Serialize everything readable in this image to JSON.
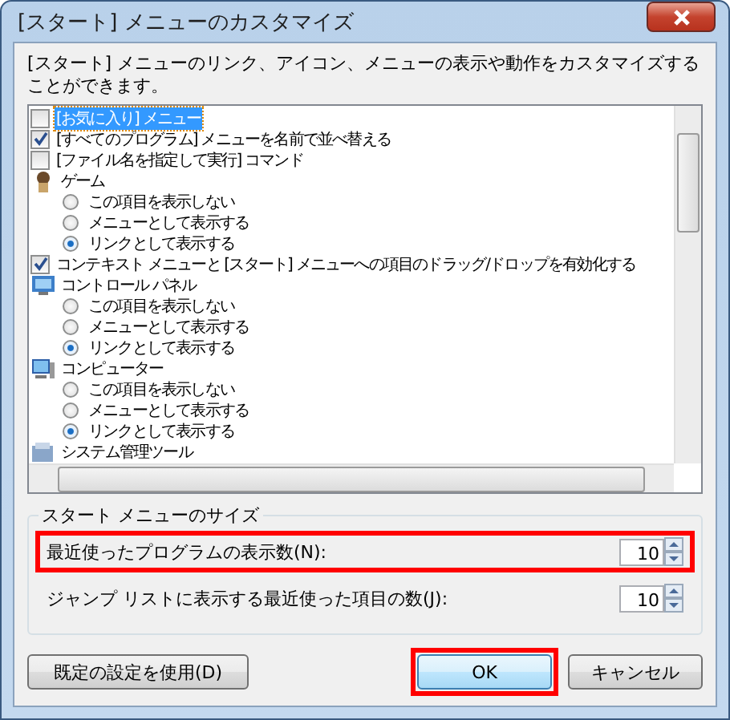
{
  "window": {
    "title": "[スタート] メニューのカスタマイズ"
  },
  "description": "[スタート] メニューのリンク、アイコン、メニューの表示や動作をカスタマイズすることができます。",
  "options": [
    {
      "kind": "checkbox",
      "label": "[お気に入り] メニュー",
      "checked": false,
      "selected": true
    },
    {
      "kind": "checkbox",
      "label": "[すべてのプログラム] メニューを名前で並べ替える",
      "checked": true,
      "selected": false
    },
    {
      "kind": "checkbox",
      "label": "[ファイル名を指定して実行] コマンド",
      "checked": false,
      "selected": false
    },
    {
      "kind": "group",
      "label": "ゲーム",
      "children": [
        {
          "label": "この項目を表示しない",
          "selected": false
        },
        {
          "label": "メニューとして表示する",
          "selected": false
        },
        {
          "label": "リンクとして表示する",
          "selected": true
        }
      ]
    },
    {
      "kind": "checkbox",
      "label": "コンテキスト メニューと [スタート] メニューへの項目のドラッグ/ドロップを有効化する",
      "checked": true,
      "selected": false
    },
    {
      "kind": "group",
      "label": "コントロール パネル",
      "children": [
        {
          "label": "この項目を表示しない",
          "selected": false
        },
        {
          "label": "メニューとして表示する",
          "selected": false
        },
        {
          "label": "リンクとして表示する",
          "selected": true
        }
      ]
    },
    {
      "kind": "group",
      "label": "コンピューター",
      "children": [
        {
          "label": "この項目を表示しない",
          "selected": false
        },
        {
          "label": "メニューとして表示する",
          "selected": false
        },
        {
          "label": "リンクとして表示する",
          "selected": true
        }
      ]
    },
    {
      "kind": "group",
      "label": "システム管理ツール"
    }
  ],
  "size_group": {
    "title": "スタート メニューのサイズ",
    "fields": [
      {
        "label": "最近使ったプログラムの表示数(N):",
        "value": "10",
        "highlighted": true
      },
      {
        "label": "ジャンプ リストに表示する最近使った項目の数(J):",
        "value": "10",
        "highlighted": false
      }
    ]
  },
  "buttons": [
    {
      "label": "既定の設定を使用(D)",
      "kind": "defaults",
      "highlighted": false,
      "default": false
    },
    {
      "label": "OK",
      "kind": "ok",
      "highlighted": true,
      "default": true
    },
    {
      "label": "キャンセル",
      "kind": "cancel",
      "highlighted": false,
      "default": false
    }
  ]
}
